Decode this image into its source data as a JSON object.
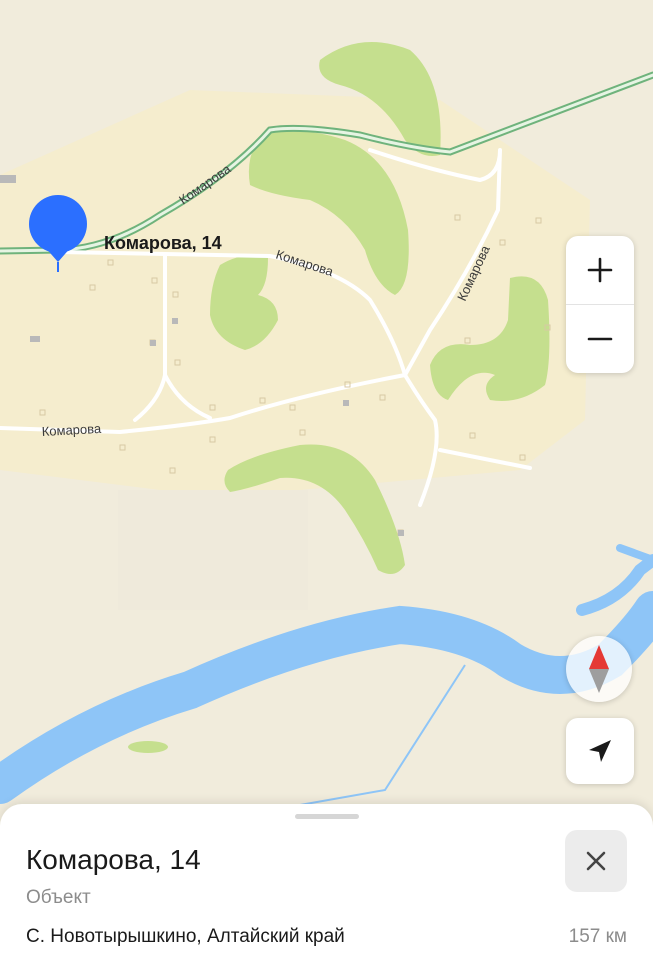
{
  "map": {
    "pin_label": "Комарова, 14",
    "road_labels": [
      "Комарова",
      "Комарова",
      "Комарова",
      "Комарова"
    ],
    "colors": {
      "land": "#f1ecdc",
      "settlement": "#f5edce",
      "forest": "#c5df8e",
      "water": "#8ec5f7",
      "highway": "#82c98e",
      "road": "#ffffff",
      "pin": "#2b6fff"
    }
  },
  "controls": {
    "zoom_in_icon": "plus-icon",
    "zoom_out_icon": "minus-icon",
    "compass_icon": "compass-icon",
    "locate_icon": "navigation-arrow-icon"
  },
  "sheet": {
    "title": "Комарова, 14",
    "subtitle": "Объект",
    "address": "С. Новотырышкино, Алтайский край",
    "distance": "157 км",
    "close_icon": "close-icon"
  }
}
